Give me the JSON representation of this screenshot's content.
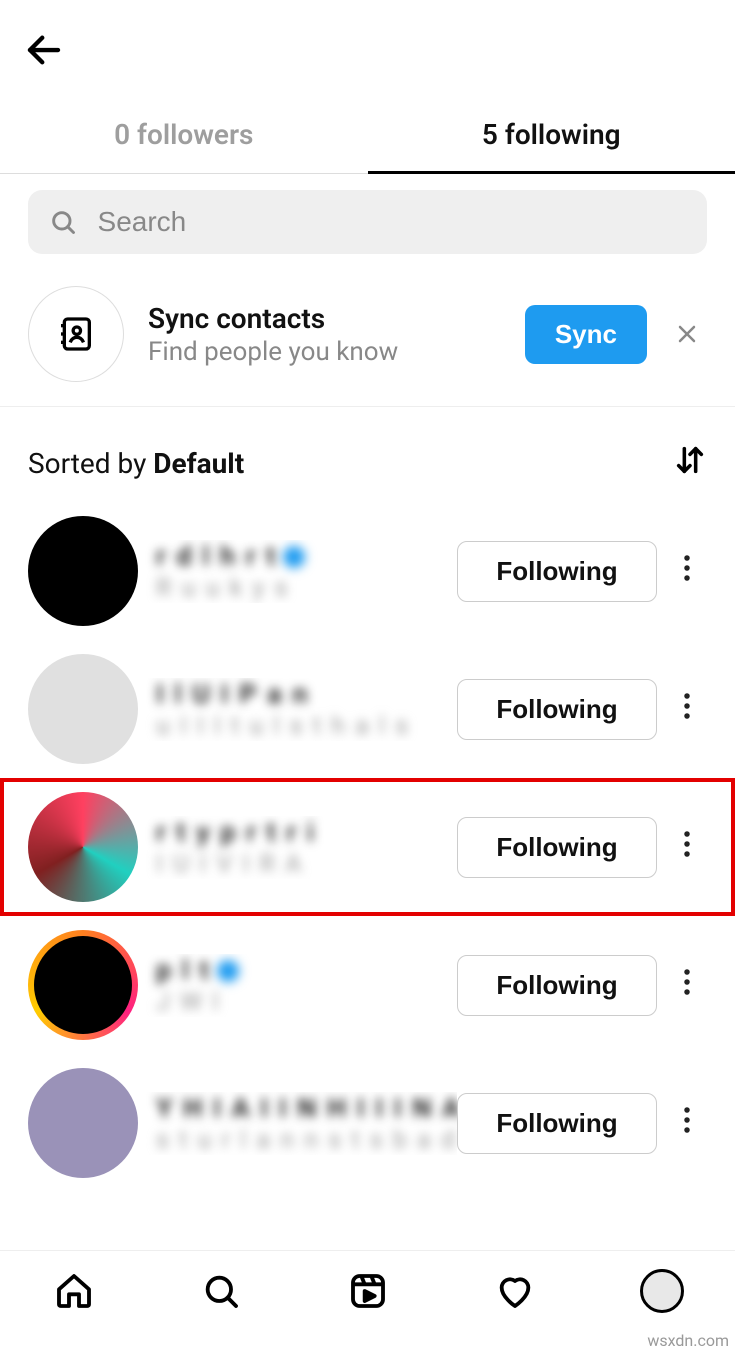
{
  "header": {},
  "tabs": {
    "followers": "0 followers",
    "following": "5 following",
    "active": "following"
  },
  "search": {
    "placeholder": "Search"
  },
  "sync": {
    "title": "Sync contacts",
    "subtitle": "Find people you know",
    "button": "Sync"
  },
  "sort": {
    "prefix": "Sorted by ",
    "value": "Default"
  },
  "users": [
    {
      "username": "r d l h r t",
      "realname": "R u u k y s",
      "verified": true,
      "button": "Following",
      "avatar": "black",
      "highlighted": false
    },
    {
      "username": "I l U I P a n",
      "realname": "u I I I t u l s t h a l s",
      "verified": false,
      "button": "Following",
      "avatar": "gray",
      "highlighted": false
    },
    {
      "username": "r t y p r t r i",
      "realname": "I U I V I R A",
      "verified": false,
      "button": "Following",
      "avatar": "colorful",
      "highlighted": true
    },
    {
      "username": "p l t",
      "realname": "J W l",
      "verified": true,
      "button": "Following",
      "avatar": "ring",
      "highlighted": false
    },
    {
      "username": "Y H I A I I N  H I I I N A I I",
      "realname": "s t u r l  a n n s   t s b a d",
      "verified": false,
      "button": "Following",
      "avatar": "purple",
      "highlighted": false
    }
  ],
  "watermark": "wsxdn.com"
}
